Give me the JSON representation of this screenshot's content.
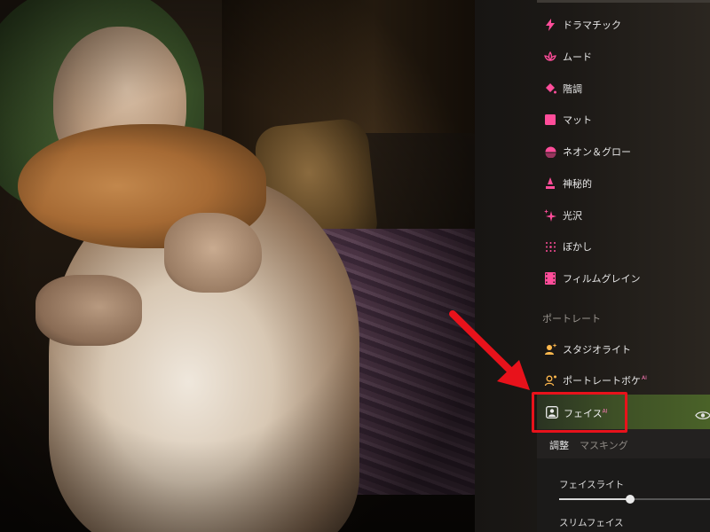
{
  "effects": [
    {
      "label": "ドラマチック",
      "icon": "bolt-icon",
      "ai": false
    },
    {
      "label": "ムード",
      "icon": "lotus-icon",
      "ai": false
    },
    {
      "label": "階調",
      "icon": "paint-bucket-icon",
      "ai": false
    },
    {
      "label": "マット",
      "icon": "square-icon",
      "ai": false
    },
    {
      "label": "ネオン＆グロー",
      "icon": "half-circle-icon",
      "ai": false
    },
    {
      "label": "神秘的",
      "icon": "mystic-icon",
      "ai": false
    },
    {
      "label": "光沢",
      "icon": "sparkle-icon",
      "ai": false
    },
    {
      "label": "ぼかし",
      "icon": "blur-dots-icon",
      "ai": false
    },
    {
      "label": "フィルムグレイン",
      "icon": "film-icon",
      "ai": false
    }
  ],
  "portrait_section": {
    "title": "ポートレート",
    "items": [
      {
        "label": "スタジオライト",
        "icon": "studio-light-icon",
        "ai": false
      },
      {
        "label": "ポートレートボケ",
        "icon": "portrait-bokeh-icon",
        "ai": true
      }
    ]
  },
  "selected_item": {
    "label": "フェイス",
    "ai_badge": "AI",
    "icon": "face-portrait-icon",
    "visibility_icon": "eye-icon"
  },
  "ai_badge": "AI",
  "tabs": [
    {
      "label": "調整",
      "active": true
    },
    {
      "label": "マスキング",
      "active": false
    }
  ],
  "sliders": [
    {
      "label": "フェイスライト",
      "value": 0.47
    },
    {
      "label": "スリムフェイス"
    }
  ],
  "colors": {
    "accent_pink": "#ff4d9a",
    "highlight_red": "#e8121b",
    "selected_green": "#4a6228"
  }
}
